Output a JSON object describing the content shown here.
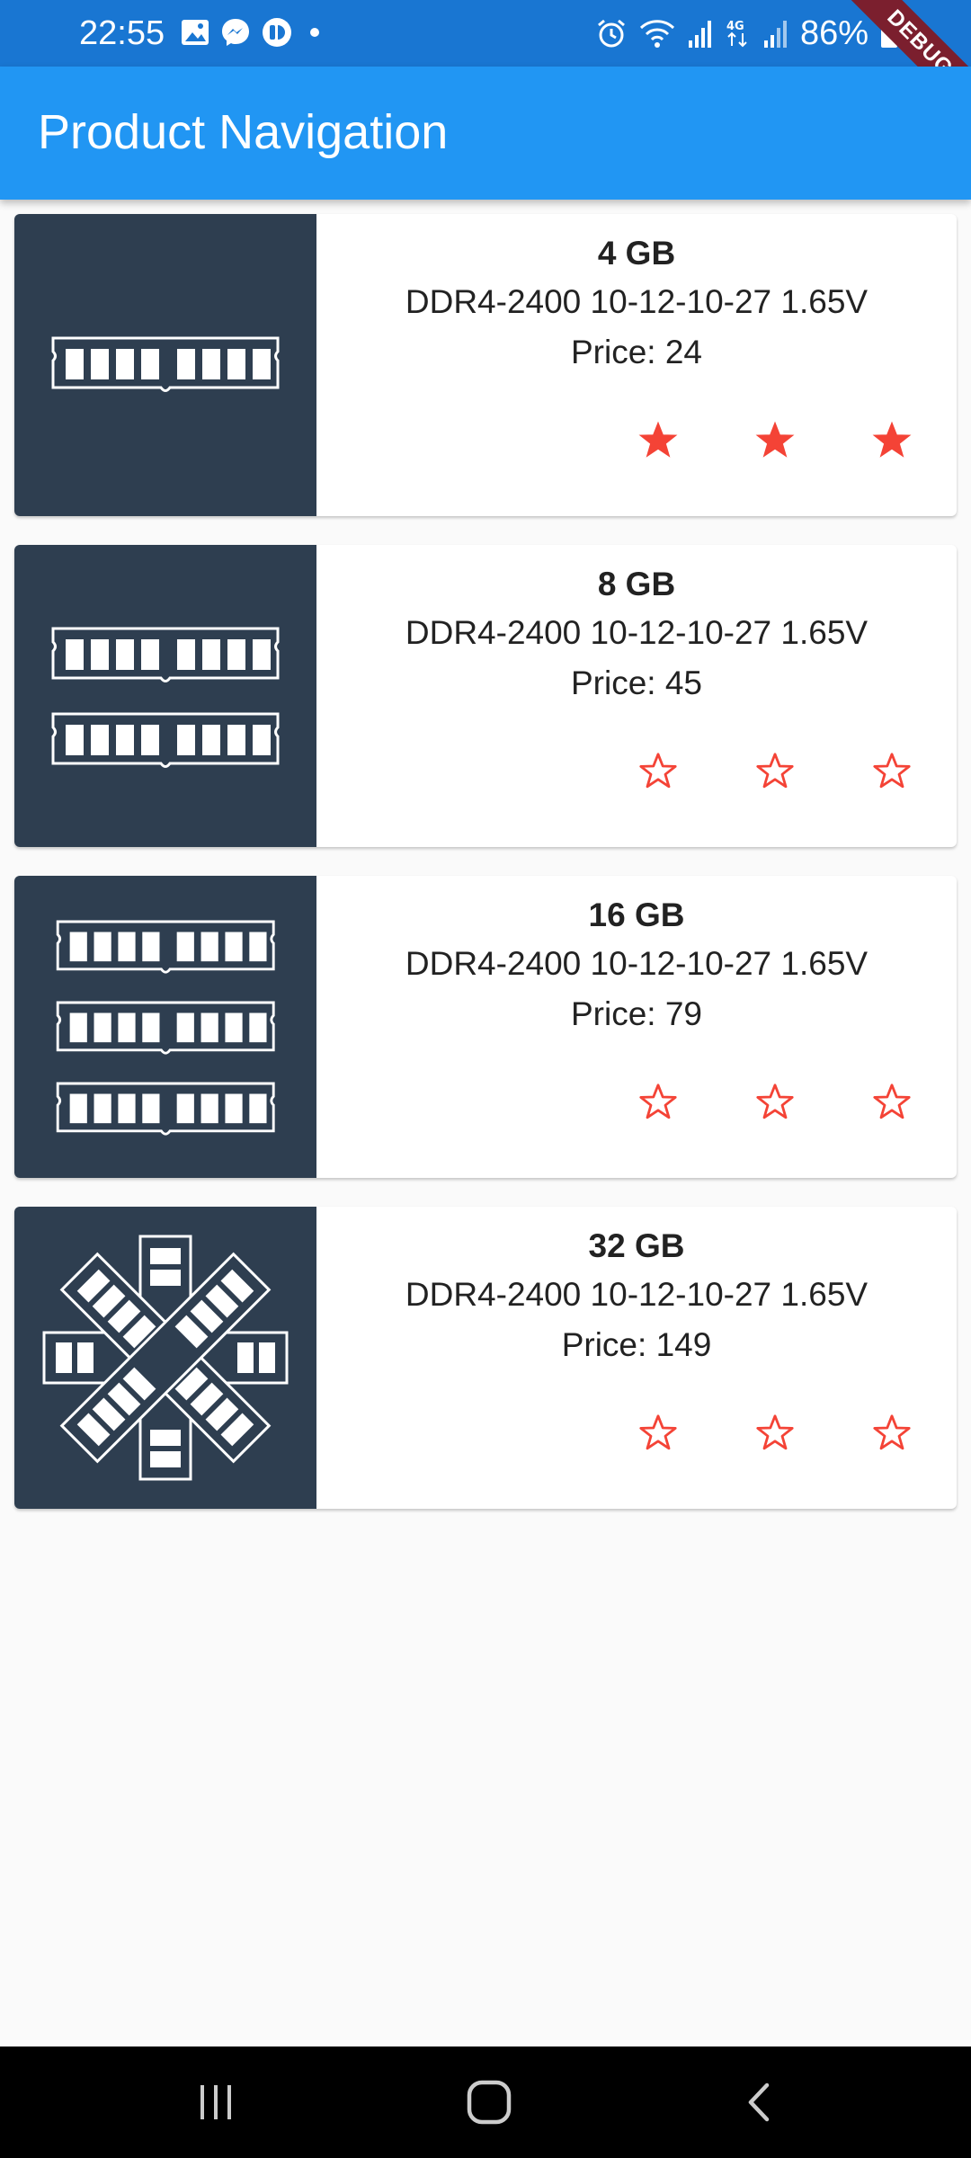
{
  "status_bar": {
    "time": "22:55",
    "battery": "86%",
    "left_icons": [
      "image-icon",
      "messenger-icon",
      "app-icon",
      "dot-icon"
    ],
    "right_icons": [
      "alarm-icon",
      "wifi-icon",
      "signal-icon",
      "4g-icon",
      "signal-icon",
      "battery-icon"
    ],
    "debug_label": "DEBUG"
  },
  "app_bar": {
    "title": "Product Navigation"
  },
  "colors": {
    "app_bar": "#2196f3",
    "status_bar": "#1976d2",
    "thumb_bg": "#2e3e50",
    "star": "#f44336"
  },
  "products": [
    {
      "title": "4 GB",
      "spec": "DDR4-2400 10-12-10-27 1.65V",
      "price_label": "Price:",
      "price": "24",
      "rating": 3,
      "max_rating": 3,
      "icon": "ram-stick-1-icon"
    },
    {
      "title": "8 GB",
      "spec": "DDR4-2400 10-12-10-27 1.65V",
      "price_label": "Price:",
      "price": "45",
      "rating": 0,
      "max_rating": 3,
      "icon": "ram-stick-2-icon"
    },
    {
      "title": "16 GB",
      "spec": "DDR4-2400 10-12-10-27 1.65V",
      "price_label": "Price:",
      "price": "79",
      "rating": 0,
      "max_rating": 3,
      "icon": "ram-stick-3-icon"
    },
    {
      "title": "32 GB",
      "spec": "DDR4-2400 10-12-10-27 1.65V",
      "price_label": "Price:",
      "price": "149",
      "rating": 0,
      "max_rating": 3,
      "icon": "ram-stick-4-icon"
    }
  ],
  "nav_bar": {
    "buttons": [
      "recents-icon",
      "home-icon",
      "back-icon"
    ]
  }
}
